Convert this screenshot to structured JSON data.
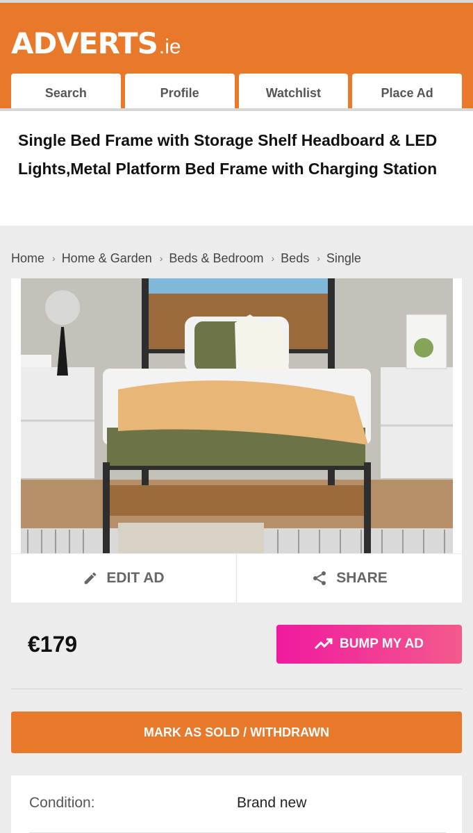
{
  "header": {
    "logo_main": "ADVERTS",
    "logo_tld": ".ie",
    "nav": [
      "Search",
      "Profile",
      "Watchlist",
      "Place Ad"
    ]
  },
  "ad": {
    "title": "Single Bed Frame with Storage Shelf Headboard & LED Lights,Metal Platform Bed Frame with Charging Station",
    "price": "€179"
  },
  "breadcrumb": [
    "Home",
    "Home & Garden",
    "Beds & Bedroom",
    "Beds",
    "Single"
  ],
  "actions": {
    "edit_label": "EDIT AD",
    "share_label": "SHARE",
    "bump_label": "BUMP MY AD",
    "sold_label": "MARK AS SOLD / WITHDRAWN"
  },
  "details": {
    "condition_label": "Condition:",
    "condition_value": "Brand new"
  },
  "colors": {
    "brand_orange": "#e8782a",
    "bump_pink": "#f0199f"
  }
}
